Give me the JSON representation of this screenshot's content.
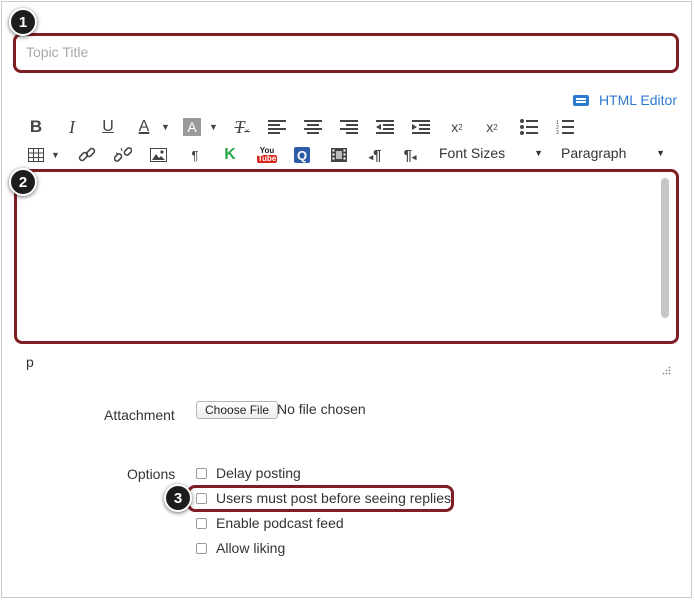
{
  "topic_title": {
    "placeholder": "Topic Title",
    "value": ""
  },
  "html_editor": {
    "label": "HTML Editor",
    "icon": "keyboard-icon"
  },
  "toolbar": {
    "bold": "B",
    "italic": "I",
    "underline": "U",
    "font_color": "A",
    "background_color": "A",
    "clear_format": "T",
    "superscript": "x",
    "subscript": "x",
    "paragraph_mark": "¶",
    "kaltura": "K",
    "youtube_top": "You",
    "youtube_bottom": "Tube",
    "quizlet": "Q",
    "ltr_mark": "¶",
    "rtl_mark": "¶",
    "font_sizes": "Font Sizes",
    "paragraph_format": "Paragraph"
  },
  "editor": {
    "path": "p"
  },
  "attachment": {
    "label": "Attachment",
    "button": "Choose File",
    "status": "No file chosen"
  },
  "options": {
    "label": "Options",
    "items": [
      {
        "label": "Delay posting",
        "checked": false
      },
      {
        "label": "Users must post before seeing replies",
        "checked": false
      },
      {
        "label": "Enable podcast feed",
        "checked": false
      },
      {
        "label": "Allow liking",
        "checked": false
      }
    ]
  },
  "callouts": [
    "1",
    "2",
    "3"
  ],
  "colors": {
    "callout": "#7e1d24",
    "link": "#2d7bd1",
    "youtube": "#d9261c",
    "kaltura": "#2aa84a",
    "quizlet": "#2b5ca8"
  }
}
